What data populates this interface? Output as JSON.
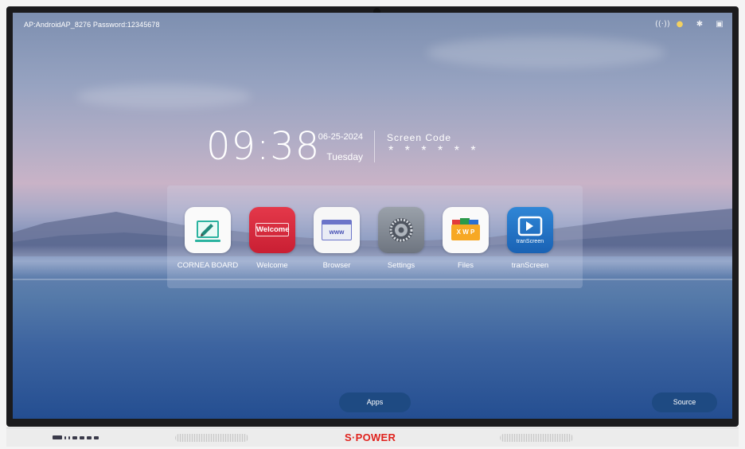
{
  "status_bar": {
    "ap_info": "AP:AndroidAP_8276  Password:12345678",
    "icons": [
      "hotspot-icon",
      "tip-icon",
      "bluetooth-icon",
      "screen-icon"
    ]
  },
  "clock": {
    "time": "09:38",
    "date": "06-25-2024",
    "weekday": "Tuesday"
  },
  "screen_code": {
    "label": "Screen Code",
    "value": "* * * * * *"
  },
  "apps": [
    {
      "label": "CORNEA BOARD",
      "icon": "whiteboard-icon"
    },
    {
      "label": "Welcome",
      "icon": "welcome-icon",
      "tile_text": "Welcome"
    },
    {
      "label": "Browser",
      "icon": "browser-icon",
      "tile_text": "www"
    },
    {
      "label": "Settings",
      "icon": "gear-icon"
    },
    {
      "label": "Files",
      "icon": "files-icon",
      "tile_text": "X W P"
    },
    {
      "label": "tranScreen",
      "icon": "transcreen-icon",
      "tile_text": "tranScreen"
    }
  ],
  "bottom": {
    "apps_label": "Apps",
    "source_label": "Source"
  },
  "brand": "S·POWER",
  "colors": {
    "button_bg": "#1e4a82",
    "welcome_red": "#d62a3d",
    "transcreen_blue": "#2477c8",
    "brand_red": "#e0231e"
  }
}
